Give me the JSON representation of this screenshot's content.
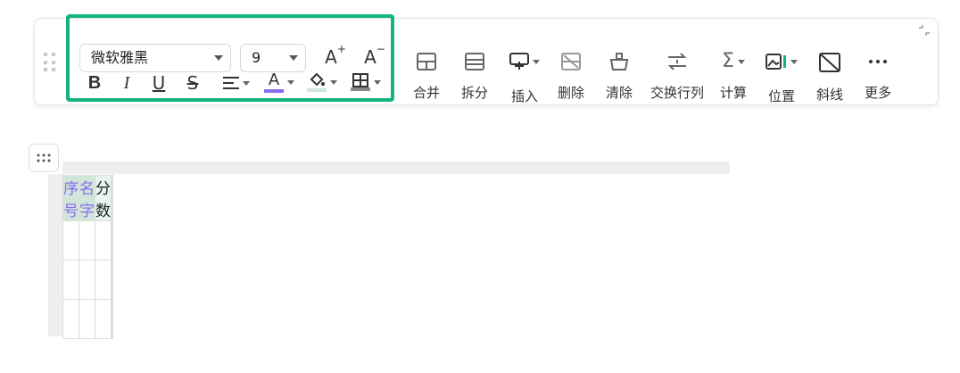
{
  "toolbar": {
    "font_family": "微软雅黑",
    "font_size": "9",
    "grow_font_label": "A",
    "shrink_font_label": "A",
    "bold_label": "B",
    "italic_label": "I",
    "underline_label": "U",
    "strike_label": "S",
    "font_color_label": "A",
    "font_color": "#8b6cf0",
    "fill_color": "#cfe6d8",
    "border_color": "#888888",
    "tools": [
      {
        "label": "合并",
        "icon": "merge-cells-icon"
      },
      {
        "label": "拆分",
        "icon": "split-cells-icon"
      },
      {
        "label": "插入",
        "icon": "insert-icon"
      },
      {
        "label": "删除",
        "icon": "delete-icon"
      },
      {
        "label": "清除",
        "icon": "clear-icon"
      },
      {
        "label": "交换行列",
        "icon": "swap-rows-cols-icon"
      },
      {
        "label": "计算",
        "icon": "sum-icon"
      },
      {
        "label": "位置",
        "icon": "image-position-icon"
      },
      {
        "label": "斜线",
        "icon": "diagonal-line-icon"
      },
      {
        "label": "更多",
        "icon": "more-icon"
      }
    ],
    "highlight_color": "#14b57a"
  },
  "table": {
    "header": [
      "序号",
      "名字",
      "分数",
      "",
      ""
    ],
    "rows": [
      [
        "",
        "",
        "",
        "",
        ""
      ],
      [
        "",
        "",
        "",
        "",
        ""
      ],
      [
        "",
        "",
        "",
        "",
        ""
      ]
    ]
  }
}
